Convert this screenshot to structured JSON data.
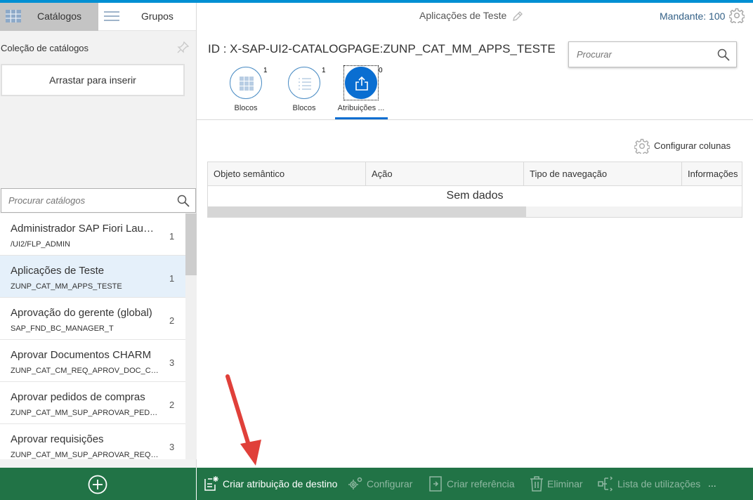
{
  "left_tabs": {
    "catalogs_label": "Catálogos",
    "groups_label": "Grupos"
  },
  "collection": {
    "title": "Coleção de catálogos",
    "drop_hint": "Arrastar para inserir"
  },
  "catalog_search": {
    "placeholder": "Procurar catálogos"
  },
  "catalogs": [
    {
      "title": "Administrador SAP Fiori Launchpad",
      "subtitle": "/UI2/FLP_ADMIN",
      "count": "1"
    },
    {
      "title": "Aplicações de Teste",
      "subtitle": "ZUNP_CAT_MM_APPS_TESTE",
      "count": "1"
    },
    {
      "title": "Aprovação do gerente (global)",
      "subtitle": "SAP_FND_BC_MANAGER_T",
      "count": "2"
    },
    {
      "title": "Aprovar Documentos CHARM",
      "subtitle": "ZUNP_CAT_CM_REQ_APROV_DOC_CHARM",
      "count": "3"
    },
    {
      "title": "Aprovar pedidos de compras",
      "subtitle": "ZUNP_CAT_MM_SUP_APROVAR_PEDIDOS",
      "count": "2"
    },
    {
      "title": "Aprovar requisições",
      "subtitle": "ZUNP_CAT_MM_SUP_APROVAR_REQUISICOES",
      "count": "3"
    }
  ],
  "header": {
    "title": "Aplicações de Teste",
    "mandante": "Mandante: 100"
  },
  "page": {
    "id_label": "ID : X-SAP-UI2-CATALOGPAGE:ZUNP_CAT_MM_APPS_TESTE",
    "search_placeholder": "Procurar"
  },
  "icon_tabs": [
    {
      "label": "Blocos",
      "count": "1",
      "icon": "grid-icon"
    },
    {
      "label": "Blocos",
      "count": "1",
      "icon": "list-icon"
    },
    {
      "label": "Atribuições ...",
      "count": "0",
      "icon": "share-icon"
    }
  ],
  "table": {
    "configure_columns": "Configurar colunas",
    "columns": [
      "Objeto semântico",
      "Ação",
      "Tipo de navegação",
      "Informações"
    ],
    "no_data": "Sem dados"
  },
  "footer": {
    "create_target_mapping": "Criar atribuição de destino",
    "configure": "Configurar",
    "create_reference": "Criar referência",
    "delete": "Eliminar",
    "where_used": "Lista de utilizações",
    "more": "..."
  },
  "colors": {
    "footer_green": "#217346",
    "accent_blue": "#0a6ed1",
    "annotation_arrow": "#e0403a"
  }
}
